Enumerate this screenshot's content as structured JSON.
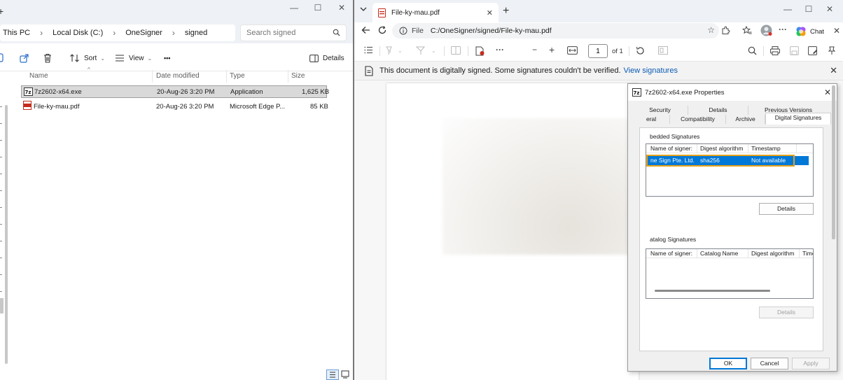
{
  "explorer": {
    "breadcrumb": [
      "This PC",
      "Local Disk (C:)",
      "OneSigner",
      "signed"
    ],
    "search_placeholder": "Search signed",
    "toolbar": {
      "sort_label": "Sort",
      "view_label": "View",
      "more_label": "•••",
      "details_label": "Details"
    },
    "columns": {
      "name": "Name",
      "date": "Date modified",
      "type": "Type",
      "size": "Size"
    },
    "files": [
      {
        "name": "7z2602-x64.exe",
        "date": "20-Aug-26 3:20 PM",
        "type": "Application",
        "size": "1,625 KB"
      },
      {
        "name": "File-ky-mau.pdf",
        "date": "20-Aug-26 3:20 PM",
        "type": "Microsoft Edge P...",
        "size": "85 KB"
      }
    ]
  },
  "edge": {
    "tab_title": "File-ky-mau.pdf",
    "url_prefix": "File",
    "url": "C:/OneSigner/signed/File-ky-mau.pdf",
    "chat_label": "Chat",
    "page_number": "1",
    "page_of": "of 1",
    "signature_message": "This document is digitally signed. Some signatures couldn't be verified.",
    "signature_link": "View signatures"
  },
  "properties": {
    "title": "7z2602-x64.exe Properties",
    "tabs_row1": [
      "Security",
      "Details",
      "Previous Versions"
    ],
    "tabs_row2": [
      "eral",
      "Compatibility",
      "Archive",
      "Digital Signatures"
    ],
    "embedded_label": "bedded Signatures",
    "emb_columns": [
      "Name of signer:",
      "Digest algorithm",
      "Timestamp"
    ],
    "emb_row": {
      "signer": "ne Sign Pte. Ltd.",
      "digest": "sha256",
      "timestamp": "Not available"
    },
    "details_btn": "Details",
    "catalog_label": "atalog Signatures",
    "cat_columns": [
      "Name of signer:",
      "Catalog Name",
      "Digest algorithm",
      "Time"
    ],
    "cat_details_btn": "Details",
    "ok_btn": "OK",
    "cancel_btn": "Cancel",
    "apply_btn": "Apply"
  },
  "colors": {
    "selection_blue": "#0078d7",
    "highlight_orange": "#e6a21a",
    "link_blue": "#0b5bb5",
    "pdf_red": "#c42b1c"
  }
}
